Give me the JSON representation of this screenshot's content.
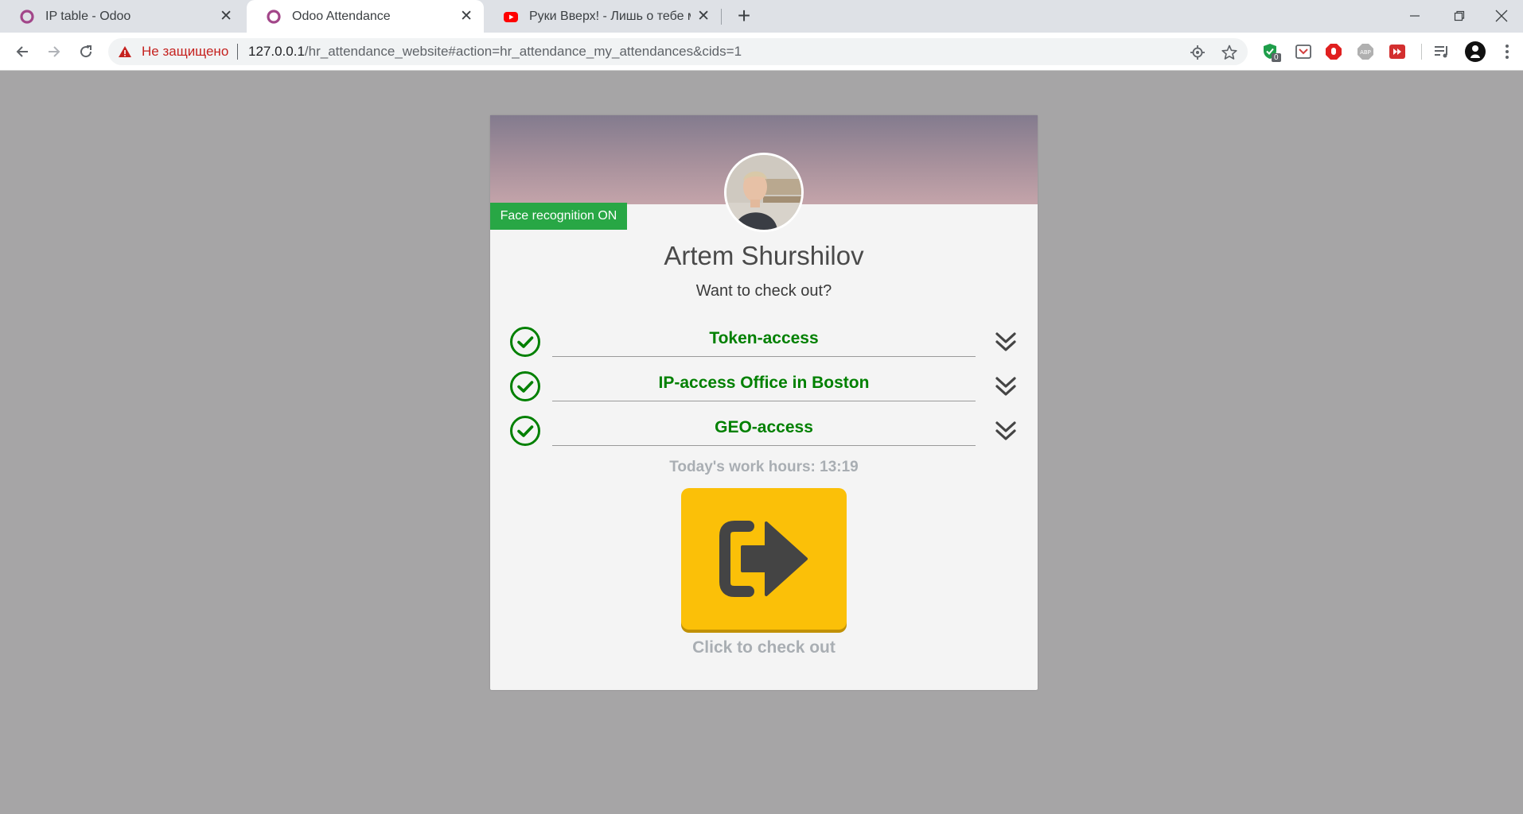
{
  "browser": {
    "tabs": [
      {
        "title": "IP table - Odoo",
        "favicon": "odoo-icon",
        "active": false
      },
      {
        "title": "Odoo Attendance",
        "favicon": "odoo-icon",
        "active": true
      },
      {
        "title": "Руки Вверх! - Лишь о тебе мечт",
        "favicon": "youtube-icon",
        "active": false
      }
    ],
    "security_label": "Не защищено",
    "url_host": "127.0.0.1",
    "url_path": "/hr_attendance_website#action=hr_attendance_my_attendances&cids=1",
    "extension_badge": "0"
  },
  "card": {
    "badge": "Face recognition ON",
    "employee_name": "Artem Shurshilov",
    "question": "Want to check out?",
    "checks": [
      {
        "label": "Token-access",
        "status": "passed"
      },
      {
        "label": "IP-access Office in Boston",
        "status": "passed"
      },
      {
        "label": "GEO-access",
        "status": "passed"
      }
    ],
    "work_hours": "Today's work hours: 13:19",
    "cta": "Click to check out"
  },
  "colors": {
    "success": "#008000",
    "badge_bg": "#28a745",
    "button_bg": "#fbc008",
    "muted_text": "#a9aeb3",
    "page_bg": "#a6a5a6"
  }
}
